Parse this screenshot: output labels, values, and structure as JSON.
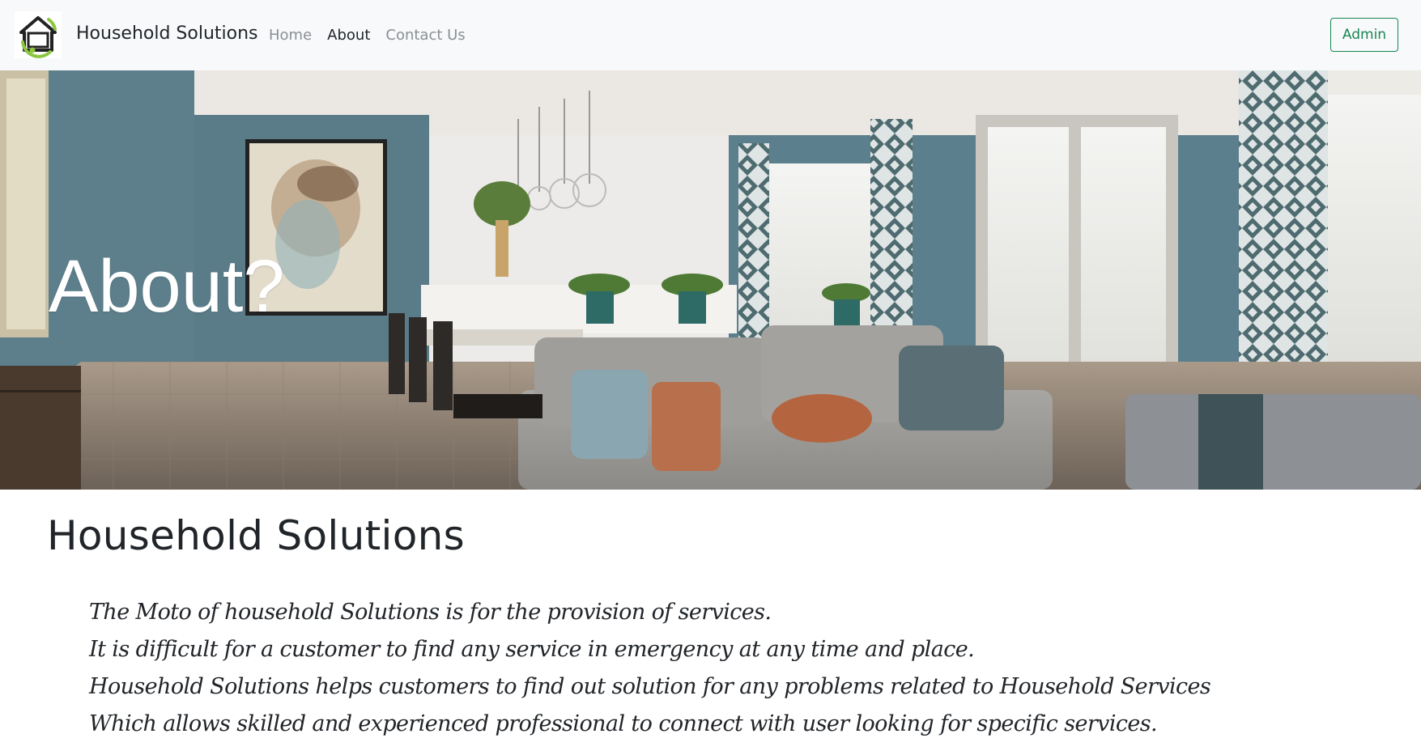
{
  "navbar": {
    "brand_name": "Household Solutions",
    "links": [
      {
        "label": "Home",
        "active": false
      },
      {
        "label": "About",
        "active": true
      },
      {
        "label": "Contact Us",
        "active": false
      }
    ],
    "admin_label": "Admin"
  },
  "hero": {
    "title": "About?"
  },
  "content": {
    "heading": "Household Solutions",
    "lines": [
      "The Moto of household Solutions is for the provision of services.",
      "It is difficult for a customer to find any service in emergency at any time and place.",
      "Household Solutions helps customers to find out solution for any problems related to Household Services",
      "Which allows skilled and experienced professional to connect with user looking for specific services."
    ]
  },
  "colors": {
    "navbar_bg": "#f8f9fa",
    "accent_green": "#198754",
    "logo_green": "#8cc63f",
    "wall_blue": "#5d7f8c"
  },
  "icons": {
    "logo": "house-logo-icon"
  }
}
